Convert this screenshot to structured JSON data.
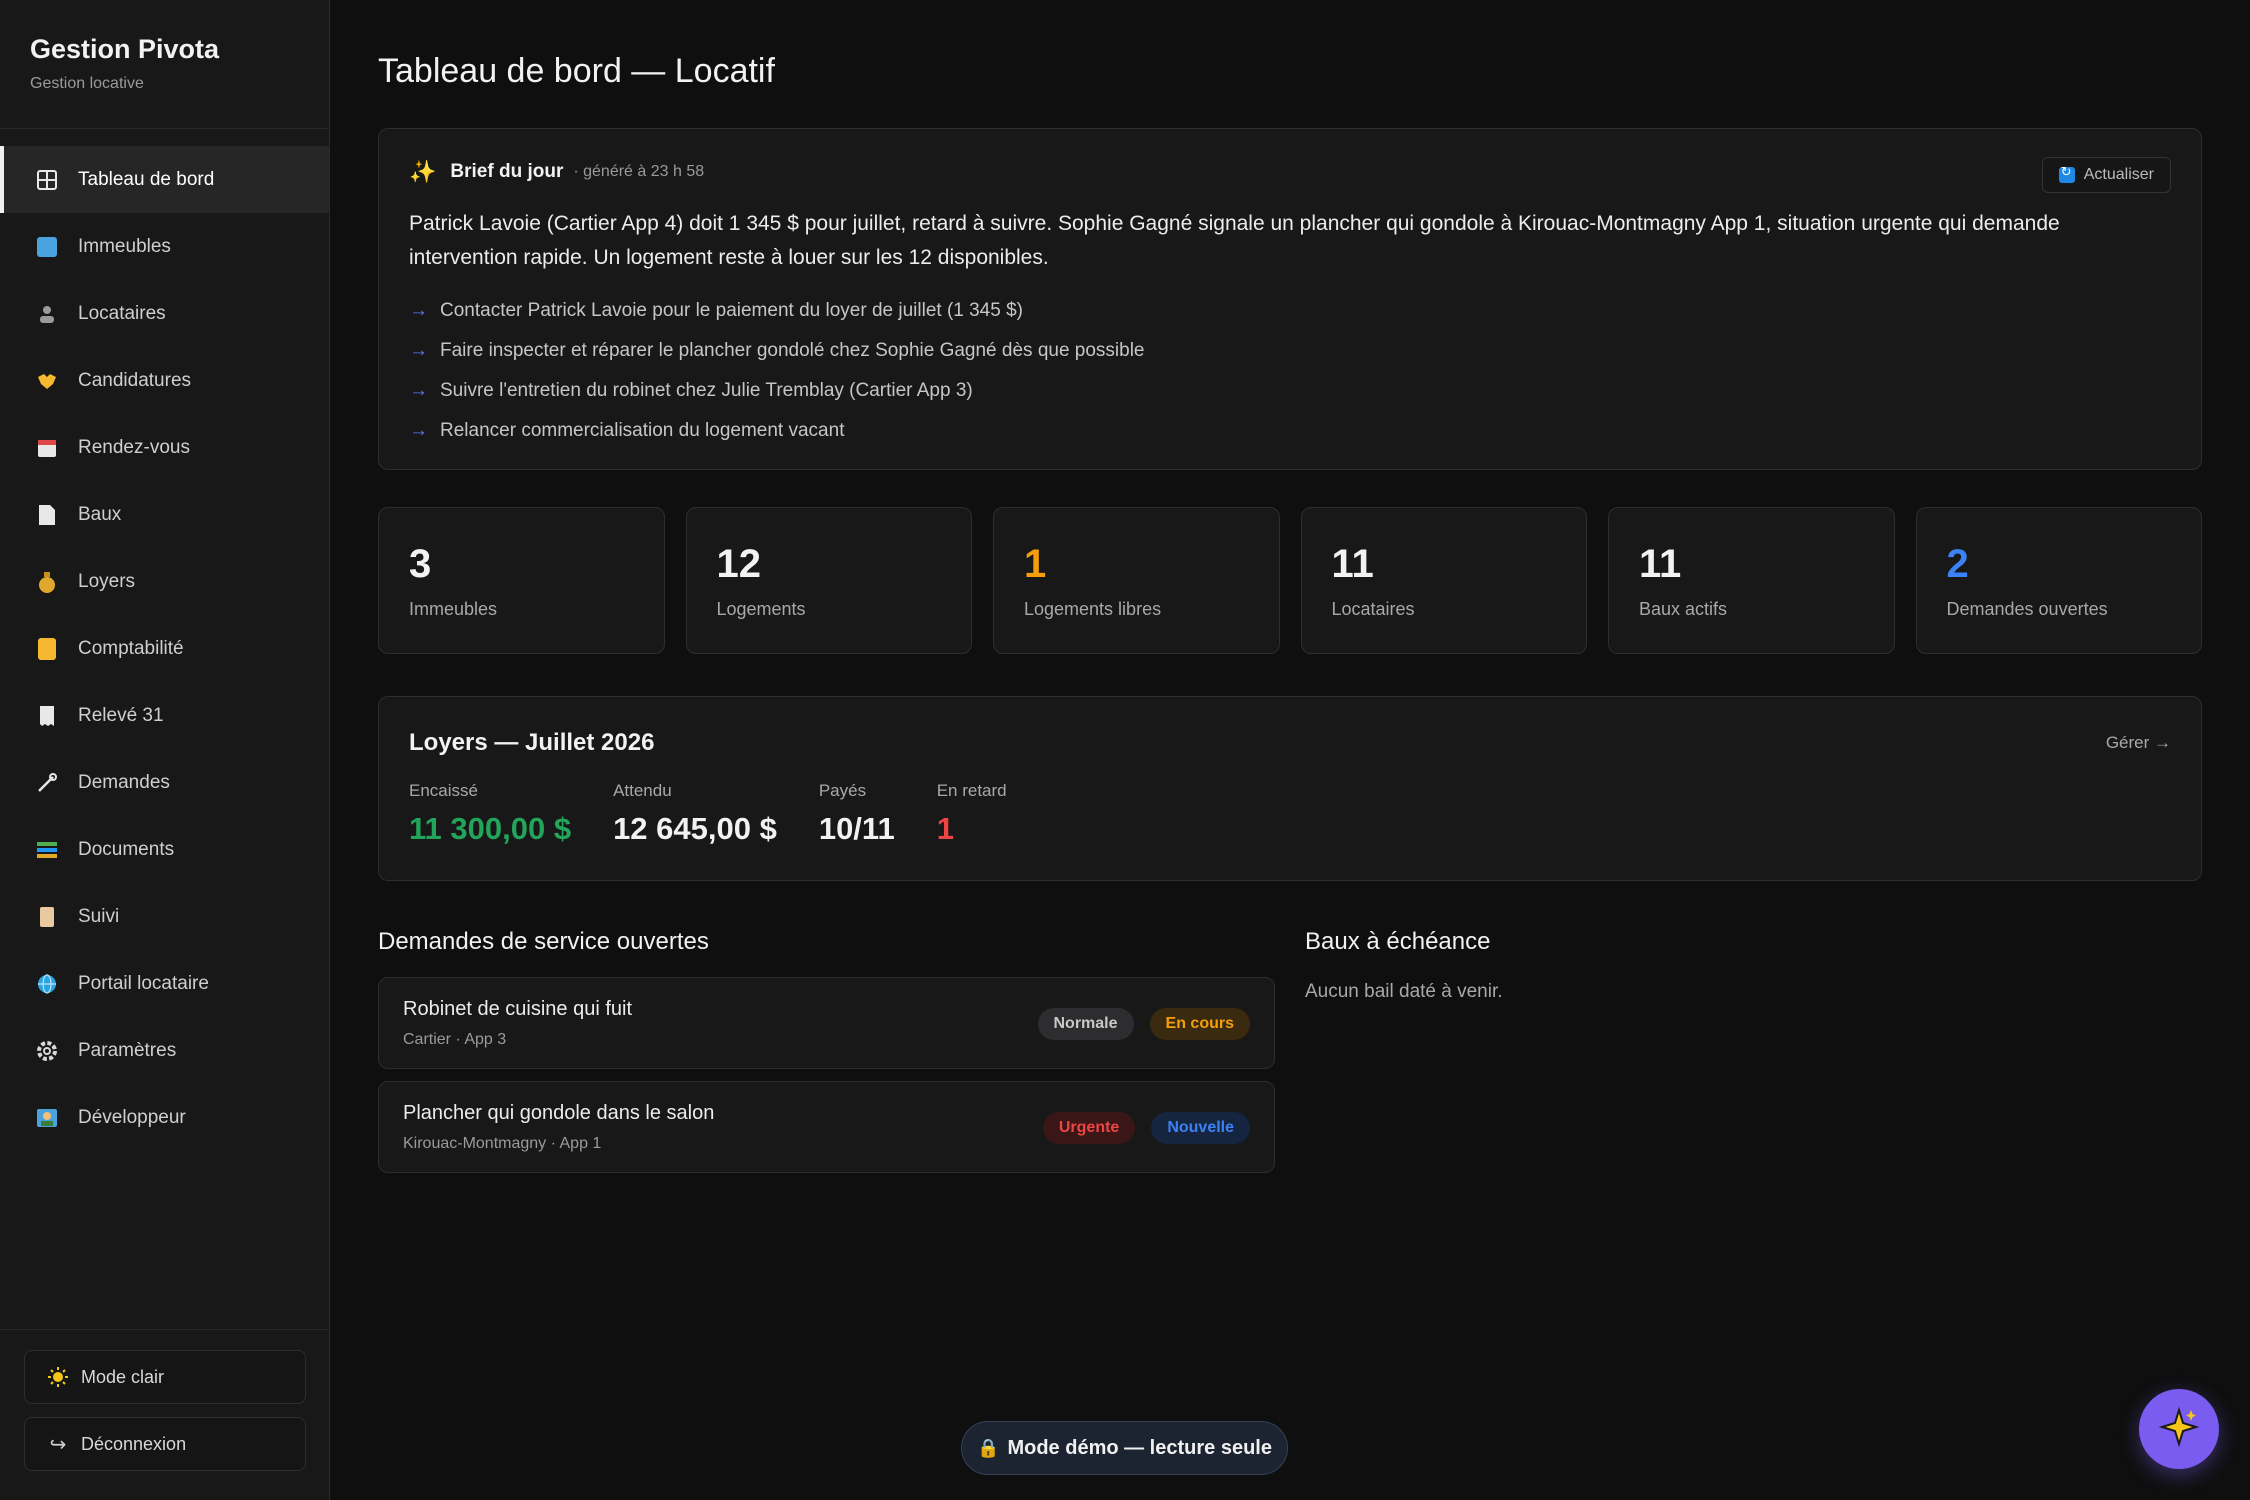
{
  "sidebar": {
    "brand_title": "Gestion Pivota",
    "brand_subtitle": "Gestion locative",
    "items": [
      {
        "label": "Tableau de bord",
        "icon": "dashboard-icon",
        "active": true
      },
      {
        "label": "Immeubles",
        "icon": "building-icon"
      },
      {
        "label": "Locataires",
        "icon": "tenant-icon"
      },
      {
        "label": "Candidatures",
        "icon": "handshake-icon"
      },
      {
        "label": "Rendez-vous",
        "icon": "calendar-icon"
      },
      {
        "label": "Baux",
        "icon": "lease-icon"
      },
      {
        "label": "Loyers",
        "icon": "moneybag-icon"
      },
      {
        "label": "Comptabilité",
        "icon": "ledger-icon"
      },
      {
        "label": "Relevé 31",
        "icon": "receipt-icon"
      },
      {
        "label": "Demandes",
        "icon": "wrench-icon"
      },
      {
        "label": "Documents",
        "icon": "documents-icon"
      },
      {
        "label": "Suivi",
        "icon": "scroll-icon"
      },
      {
        "label": "Portail locataire",
        "icon": "globe-icon"
      },
      {
        "label": "Paramètres",
        "icon": "gear-icon"
      },
      {
        "label": "Développeur",
        "icon": "developer-icon"
      }
    ],
    "light_mode_label": "Mode clair",
    "logout_label": "Déconnexion"
  },
  "page": {
    "title": "Tableau de bord — Locatif"
  },
  "brief": {
    "title": "Brief du jour",
    "meta": "· généré à 23 h 58",
    "refresh_label": "Actualiser",
    "text": "Patrick Lavoie (Cartier App 4) doit 1 345 $ pour juillet, retard à suivre. Sophie Gagné signale un plancher qui gondole à Kirouac-Montmagny App 1, situation urgente qui demande intervention rapide. Un logement reste à louer sur les 12 disponibles.",
    "actions": [
      "Contacter Patrick Lavoie pour le paiement du loyer de juillet (1 345 $)",
      "Faire inspecter et réparer le plancher gondolé chez Sophie Gagné dès que possible",
      "Suivre l'entretien du robinet chez Julie Tremblay (Cartier App 3)",
      "Relancer commercialisation du logement vacant"
    ]
  },
  "stats": [
    {
      "value": "3",
      "label": "Immeubles"
    },
    {
      "value": "12",
      "label": "Logements"
    },
    {
      "value": "1",
      "label": "Logements libres",
      "color": "#f59e0b"
    },
    {
      "value": "11",
      "label": "Locataires"
    },
    {
      "value": "11",
      "label": "Baux actifs"
    },
    {
      "value": "2",
      "label": "Demandes ouvertes",
      "color": "#3b82f6"
    }
  ],
  "rent": {
    "title": "Loyers — Juillet 2026",
    "manage_label": "Gérer →",
    "collected_label": "Encaissé",
    "collected_value": "11 300,00 $",
    "expected_label": "Attendu",
    "expected_value": "12 645,00 $",
    "paid_label": "Payés",
    "paid_value": "10/11",
    "late_label": "En retard",
    "late_value": "1"
  },
  "requests": {
    "title": "Demandes de service ouvertes",
    "items": [
      {
        "title": "Robinet de cuisine qui fuit",
        "location": "Cartier · App 3",
        "priority": "Normale",
        "status": "En cours"
      },
      {
        "title": "Plancher qui gondole dans le salon",
        "location": "Kirouac-Montmagny · App 1",
        "priority": "Urgente",
        "status": "Nouvelle"
      }
    ]
  },
  "leases": {
    "title": "Baux à échéance",
    "empty_text": "Aucun bail daté à venir."
  },
  "demo_label": "Mode démo — lecture seule",
  "colors": {
    "accent_green": "#22a55b",
    "accent_red": "#ef4444",
    "accent_orange": "#f59e0b",
    "accent_blue": "#3b82f6",
    "fab_purple": "#7b5cf0"
  }
}
